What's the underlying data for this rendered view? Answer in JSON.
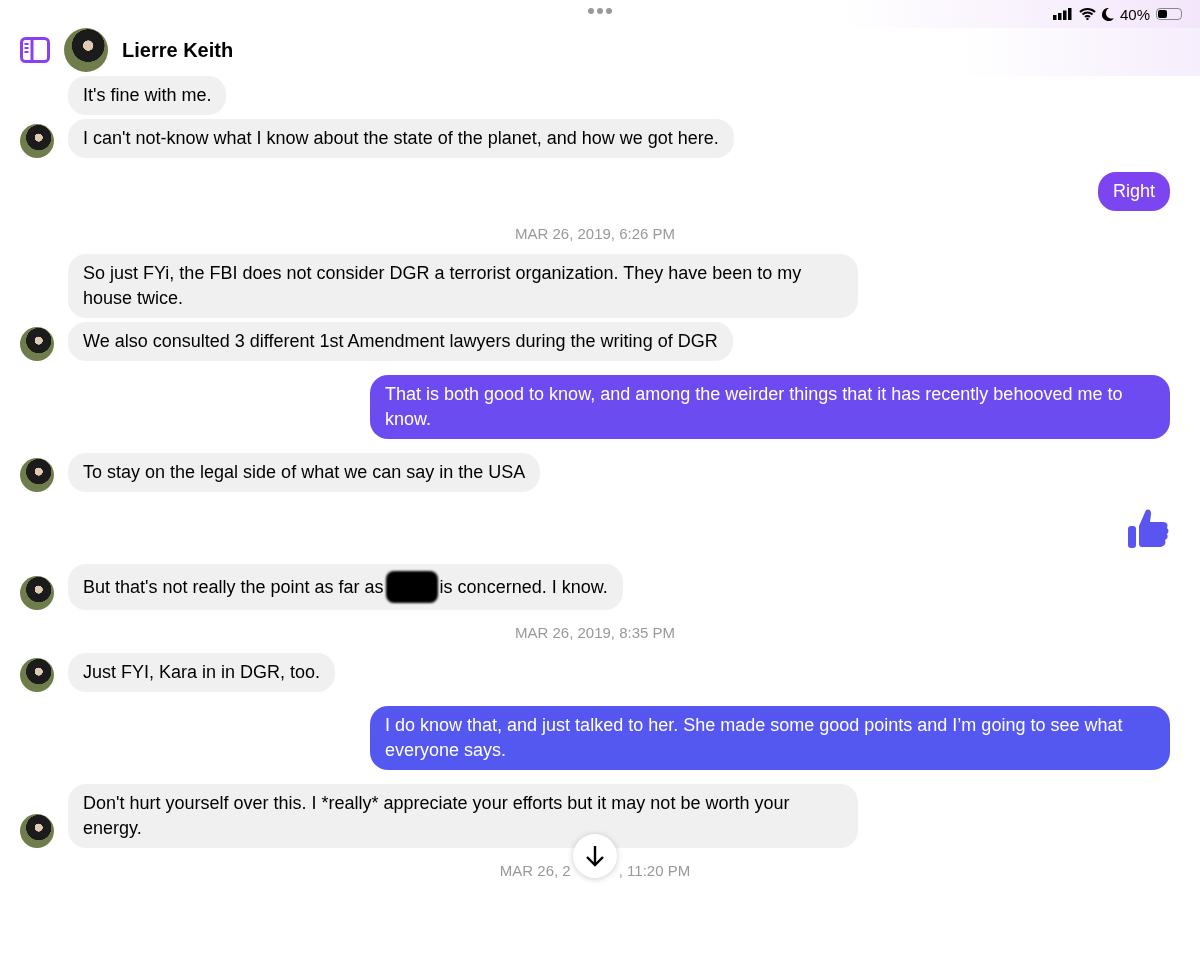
{
  "status_bar": {
    "battery_percent": "40%"
  },
  "header": {
    "contact_name": "Lierre Keith"
  },
  "messages": [
    {
      "kind": "in",
      "text": "It's fine with me.",
      "avatar": false
    },
    {
      "kind": "in",
      "text": "I can't not-know what I know about the state of the planet, and how we got here.",
      "avatar": true
    },
    {
      "kind": "out",
      "text": "Right"
    },
    {
      "kind": "timestamp",
      "parts": [
        "MAR 26, 2019, 6:26 PM"
      ]
    },
    {
      "kind": "in",
      "text": "So just FYi, the FBI does not consider DGR a terrorist organization. They have been to my house twice.",
      "avatar": false
    },
    {
      "kind": "in",
      "text": "We also consulted 3 different 1st Amendment lawyers during the writing of DGR",
      "avatar": true
    },
    {
      "kind": "out",
      "text": "That is both good to know, and among the weirder things that it has recently behooved me to know."
    },
    {
      "kind": "in",
      "text": "To stay on the legal side of what we can say in the USA",
      "avatar": true
    },
    {
      "kind": "like"
    },
    {
      "kind": "in",
      "segments": [
        {
          "kind": "text",
          "text": "But that's not really the point as far as"
        },
        {
          "kind": "redaction"
        },
        {
          "kind": "text",
          "text": "is concerned. I know."
        }
      ],
      "avatar": true
    },
    {
      "kind": "timestamp",
      "parts": [
        "MAR 26, 2019, 8:35 PM"
      ]
    },
    {
      "kind": "in",
      "text": "Just FYI, Kara in in DGR, too.",
      "avatar": true
    },
    {
      "kind": "out",
      "text": "I do know that, and just talked to her. She made some good points and I’m going to see what everyone says."
    },
    {
      "kind": "in",
      "text": "Don't hurt yourself over this. I *really* appreciate your efforts but it may not be worth your energy.",
      "avatar": true
    },
    {
      "kind": "timestamp",
      "parts": [
        "MAR 26, 2",
        ", 11:20 PM"
      ],
      "scroll_button": true
    }
  ]
}
